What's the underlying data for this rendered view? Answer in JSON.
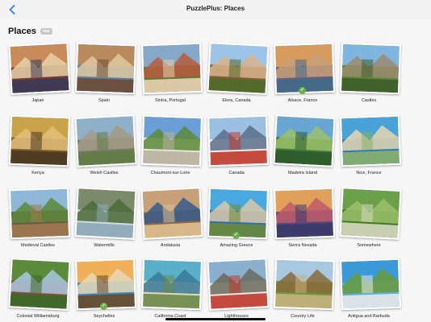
{
  "app": {
    "title": "PuzzlePlus: Places"
  },
  "page": {
    "title": "Places",
    "badge": "nav"
  },
  "icons": {
    "back": "chevron-left-icon",
    "complete": "checkmark-icon"
  },
  "accent": "#6ab04c",
  "places": [
    {
      "label": "Japan",
      "completed": false
    },
    {
      "label": "Spain",
      "completed": false
    },
    {
      "label": "Sintra, Portugal",
      "completed": false
    },
    {
      "label": "Elora, Canada",
      "completed": false
    },
    {
      "label": "Alsace, France",
      "completed": true
    },
    {
      "label": "Castles",
      "completed": false
    },
    {
      "label": "Kenya",
      "completed": false
    },
    {
      "label": "Welsh Castles",
      "completed": false
    },
    {
      "label": "Chaumont-sur-Loire",
      "completed": false
    },
    {
      "label": "Canada",
      "completed": false
    },
    {
      "label": "Madeira Island",
      "completed": false
    },
    {
      "label": "Nice, France",
      "completed": false
    },
    {
      "label": "Medieval Castles",
      "completed": false
    },
    {
      "label": "Watermills",
      "completed": false
    },
    {
      "label": "Andalusia",
      "completed": false
    },
    {
      "label": "Amazing Greece",
      "completed": true
    },
    {
      "label": "Sierra Nevada",
      "completed": false
    },
    {
      "label": "Somewhere",
      "completed": false
    },
    {
      "label": "Colonial Williamsburg",
      "completed": false
    },
    {
      "label": "Seychelles",
      "completed": true
    },
    {
      "label": "California Coast",
      "completed": false
    },
    {
      "label": "Lighthouses",
      "completed": false
    },
    {
      "label": "Country Life",
      "completed": false
    },
    {
      "label": "Antigua and Barbuda",
      "completed": false
    }
  ]
}
